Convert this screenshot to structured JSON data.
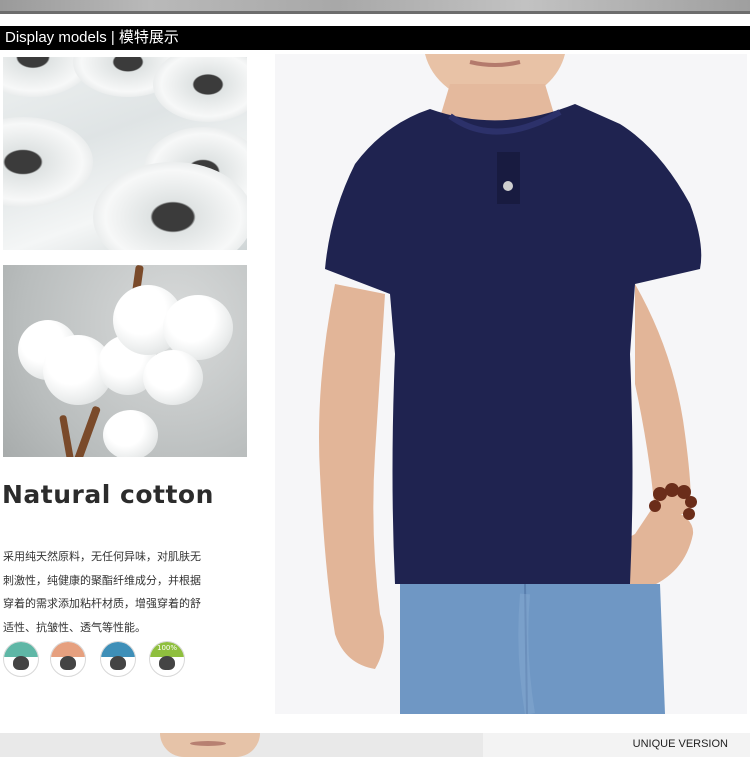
{
  "header": {
    "title": "Display models | 模特展示"
  },
  "feature": {
    "title": "Natural cotton",
    "description_lines": [
      "采用纯天然原料，无任何异味，对肌肤无",
      "刺激性，纯健康的聚酯纤维成分，并根据",
      "穿着的需求添加粘杆材质，增强穿着的舒",
      "适性、抗皱性、透气等性能。"
    ],
    "badges": [
      {
        "icon": "cotton-flower-icon",
        "color": "#5fb7a6",
        "label": ""
      },
      {
        "icon": "cotton-flower-icon",
        "color": "#e6a07f",
        "label": ""
      },
      {
        "icon": "cotton-flower-icon",
        "color": "#3e8fb8",
        "label": ""
      },
      {
        "icon": "cotton-flower-icon",
        "color": "#8fbf3e",
        "label": "100%"
      }
    ]
  },
  "product": {
    "shirt_color": "#1f2350",
    "jeans_color": "#6f97c4"
  },
  "footer": {
    "label": "UNIQUE VERSION"
  }
}
